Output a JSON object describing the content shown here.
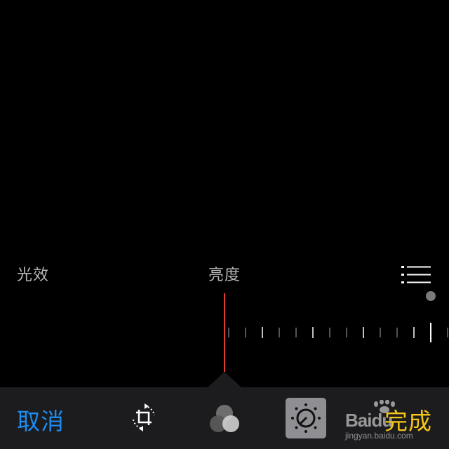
{
  "adjust_panel": {
    "category_label": "光效",
    "parameter_label": "亮度",
    "list_icon": "list-icon",
    "value": 0
  },
  "toolbar": {
    "cancel_label": "取消",
    "done_label": "完成",
    "tools": [
      {
        "icon": "crop-rotate-icon",
        "active": false
      },
      {
        "icon": "filters-icon",
        "active": false
      },
      {
        "icon": "adjust-dial-icon",
        "active": true
      }
    ]
  },
  "colors": {
    "background": "#000000",
    "toolbar": "#1c1c1e",
    "cancel": "#1e8cf0",
    "done": "#f5c518",
    "slider_indicator": "#e03c31",
    "active_tool_bg": "#8e8e93"
  },
  "watermark": {
    "logo_text": "Baidu",
    "url": "jingyan.baidu.com"
  }
}
